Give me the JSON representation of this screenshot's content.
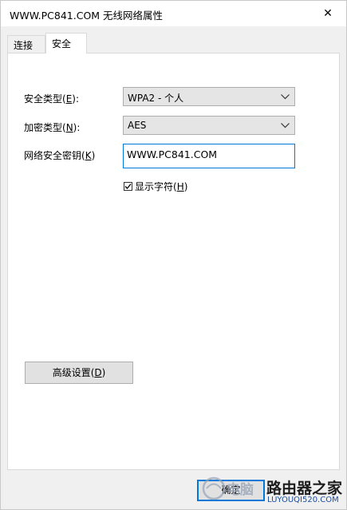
{
  "window": {
    "title": "WWW.PC841.COM 无线网络属性",
    "close_glyph": "✕"
  },
  "tabs": [
    {
      "label": "连接",
      "active": false
    },
    {
      "label": "安全",
      "active": true
    }
  ],
  "security": {
    "type_label": "安全类型(",
    "type_accel": "E",
    "type_label_end": "):",
    "type_value": "WPA2 - 个人",
    "encryption_label": "加密类型(",
    "encryption_accel": "N",
    "encryption_label_end": "):",
    "encryption_value": "AES",
    "key_label": "网络安全密钥(",
    "key_accel": "K",
    "key_label_end": ")",
    "key_value": "WWW.PC841.COM",
    "show_chars_label": "显示字符(",
    "show_chars_accel": "H",
    "show_chars_label_end": ")",
    "show_chars_checked": true
  },
  "advanced_button": {
    "label": "高级设置(",
    "accel": "D",
    "label_end": ")"
  },
  "ok_button": {
    "label": "确定"
  },
  "watermark": {
    "brand": "路由器之家",
    "url": "LUYOUQI520.COM",
    "logo_text": "电脑"
  },
  "colors": {
    "accent": "#0078d7",
    "panel_bg": "#ffffff",
    "window_bg": "#f0f0f0"
  }
}
